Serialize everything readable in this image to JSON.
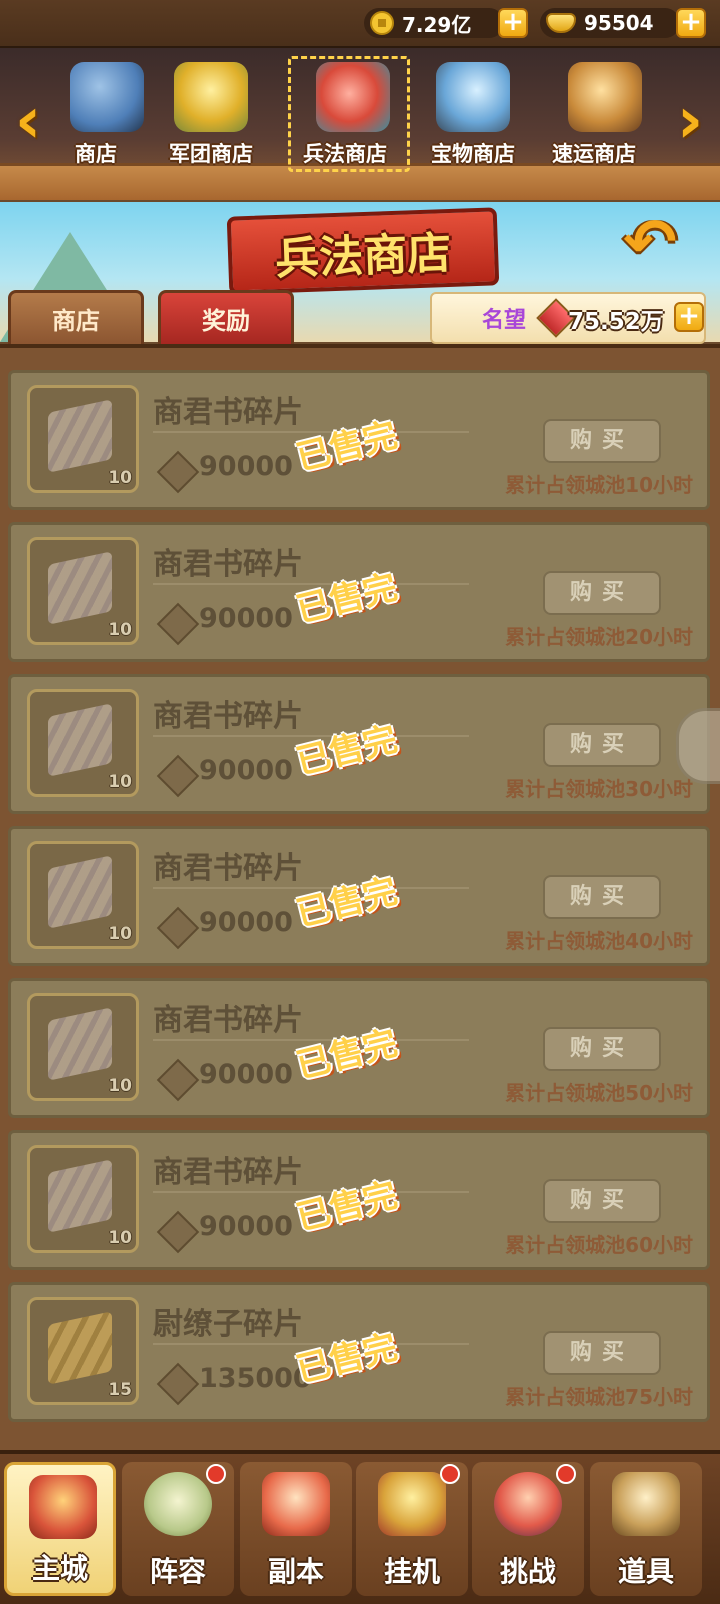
{
  "currency": {
    "coins": "7.29亿",
    "ingots": "95504"
  },
  "shops": [
    {
      "label": "商店",
      "icon": "helmet-icon",
      "color": "#4f7fb8"
    },
    {
      "label": "军团商店",
      "icon": "gold-ingot-pile-icon",
      "color": "#e0b02a"
    },
    {
      "label": "兵法商店",
      "icon": "red-gem-banner-icon",
      "color": "#d94a3a"
    },
    {
      "label": "宝物商店",
      "icon": "treasure-book-icon",
      "color": "#6aa7d8"
    },
    {
      "label": "速运商店",
      "icon": "cargo-crates-icon",
      "color": "#c98a3a"
    }
  ],
  "title": "兵法商店",
  "tabs": {
    "shop": "商店",
    "reward": "奖励"
  },
  "fame": {
    "label": "名望",
    "value": "75.52万"
  },
  "items": [
    {
      "name": "商君书碎片",
      "qty": "10",
      "price": "90000",
      "status": "已售完",
      "buy": "购买",
      "requirement": "累计占领城池10小时",
      "icon": "scroll-icon"
    },
    {
      "name": "商君书碎片",
      "qty": "10",
      "price": "90000",
      "status": "已售完",
      "buy": "购买",
      "requirement": "累计占领城池20小时",
      "icon": "scroll-icon"
    },
    {
      "name": "商君书碎片",
      "qty": "10",
      "price": "90000",
      "status": "已售完",
      "buy": "购买",
      "requirement": "累计占领城池30小时",
      "icon": "scroll-icon"
    },
    {
      "name": "商君书碎片",
      "qty": "10",
      "price": "90000",
      "status": "已售完",
      "buy": "购买",
      "requirement": "累计占领城池40小时",
      "icon": "scroll-icon"
    },
    {
      "name": "商君书碎片",
      "qty": "10",
      "price": "90000",
      "status": "已售完",
      "buy": "购买",
      "requirement": "累计占领城池50小时",
      "icon": "scroll-icon"
    },
    {
      "name": "商君书碎片",
      "qty": "10",
      "price": "90000",
      "status": "已售完",
      "buy": "购买",
      "requirement": "累计占领城池60小时",
      "icon": "scroll-icon"
    },
    {
      "name": "尉缭子碎片",
      "qty": "15",
      "price": "135000",
      "status": "已售完",
      "buy": "购买",
      "requirement": "累计占领城池75小时",
      "icon": "gold-scroll-icon"
    }
  ],
  "nav": [
    {
      "label": "主城",
      "icon": "palace-icon",
      "color": "#d9543a"
    },
    {
      "label": "阵容",
      "icon": "formation-scroll-icon",
      "color": "#b8c98a"
    },
    {
      "label": "副本",
      "icon": "map-scroll-icon",
      "color": "#e86a4a"
    },
    {
      "label": "挂机",
      "icon": "treasure-bag-icon",
      "color": "#d9a33a"
    },
    {
      "label": "挑战",
      "icon": "duel-heroes-icon",
      "color": "#e25a4a"
    },
    {
      "label": "道具",
      "icon": "item-bag-icon",
      "color": "#c9a05a"
    }
  ]
}
